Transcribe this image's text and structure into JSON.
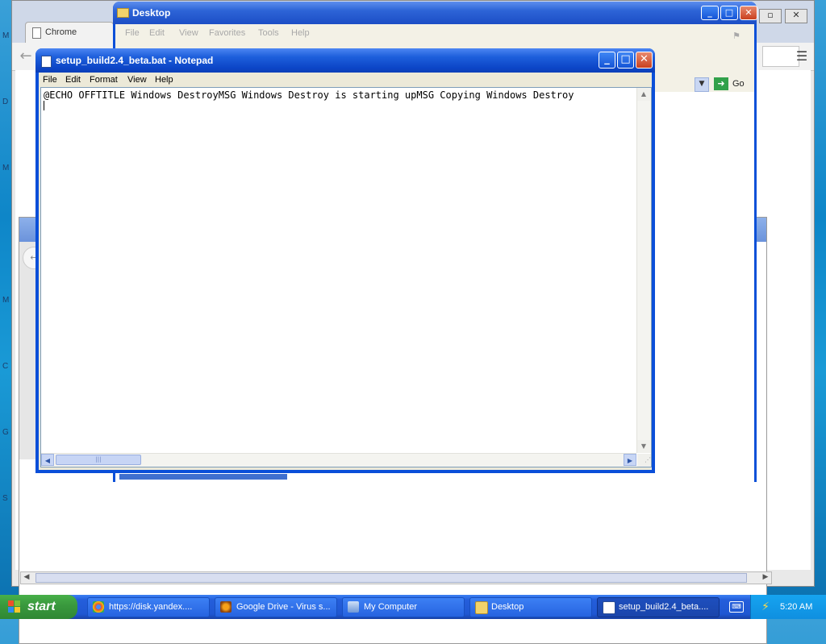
{
  "chrome": {
    "tab_label": "Chrome",
    "left_letters": [
      "M",
      "D",
      "M",
      "M",
      "C",
      "G",
      "S"
    ]
  },
  "explorer": {
    "title": "Desktop",
    "menu": [
      "File",
      "Edit",
      "View",
      "Favorites",
      "Tools",
      "Help"
    ],
    "go_label": "Go"
  },
  "notepad": {
    "title": "setup_build2.4_beta.bat - Notepad",
    "menu": [
      "File",
      "Edit",
      "Format",
      "View",
      "Help"
    ],
    "content": "@ECHO OFFTITLE Windows DestroyMSG Windows Destroy is starting upMSG Copying Windows Destroy"
  },
  "taskbar": {
    "start_label": "start",
    "tasks": [
      {
        "label": "https://disk.yandex....",
        "icon": "chrome-icon"
      },
      {
        "label": "Google Drive - Virus s...",
        "icon": "firefox-icon"
      },
      {
        "label": "My Computer",
        "icon": "my-computer-icon"
      },
      {
        "label": "Desktop",
        "icon": "folder-icon"
      },
      {
        "label": "setup_build2.4_beta....",
        "icon": "notepad-icon",
        "active": true
      }
    ],
    "clock": "5:20 AM"
  },
  "colors": {
    "xp_title_blue": "#0a4fd9",
    "start_green": "#3a9a3e",
    "taskbar_blue": "#245edb"
  }
}
